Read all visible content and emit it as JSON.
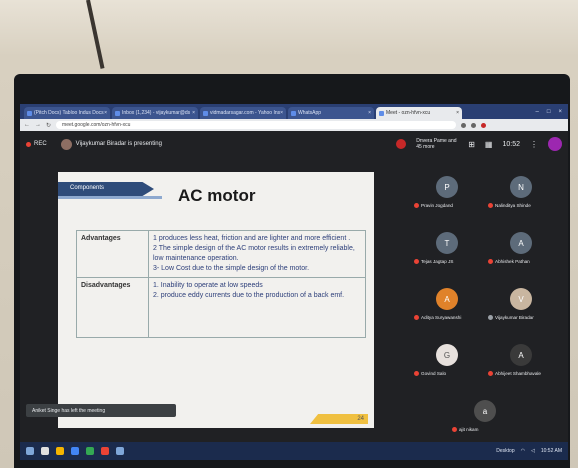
{
  "browser": {
    "tabs": [
      {
        "label": "(Pitch Docs) Tabloo Indus Docs"
      },
      {
        "label": "Inbox (1,234) - vijaykumar@ds"
      },
      {
        "label": "vidmadarsagar.com - Yahoo Ins"
      },
      {
        "label": "WhatsApp"
      },
      {
        "label": "Meet - ozn-hfvn-xcu",
        "active": true
      }
    ],
    "url": "meet.google.com/ozn-hfvn-xcu"
  },
  "meet": {
    "rec_label": "REC",
    "presenting_text": "Vijaykumar Biradar is presenting",
    "participants_label": "Dnvera Pame and 45 more",
    "clock": "10:52",
    "toast": "Aniket Singe has left the meeting",
    "participants": [
      {
        "name": "Pravin Jogdand",
        "initial": "P"
      },
      {
        "name": "Nalinditya Shinde",
        "initial": "N"
      },
      {
        "name": "Tejas Jagtap JS",
        "initial": "T"
      },
      {
        "name": "Abhishek Pathan",
        "initial": "A"
      },
      {
        "name": "Aditya Suryawanshi",
        "initial": "A"
      },
      {
        "name": "Vijaykumar Biradar",
        "initial": "V"
      },
      {
        "name": "Govind Salo",
        "initial": "G"
      },
      {
        "name": "Abhijeet Shambhavale",
        "initial": "A"
      },
      {
        "name": "ajit nikam",
        "initial": "a"
      }
    ]
  },
  "slide": {
    "tag": "Components",
    "title": "AC motor",
    "rows": [
      {
        "head": "Advantages",
        "lines": [
          "1 produces less heat, friction and are lighter and more efficient .",
          "2 The simple design of the AC motor results in extremely reliable, low maintenance operation.",
          "3- Low Cost due to the simple design of the motor."
        ]
      },
      {
        "head": "Disadvantages",
        "lines": [
          "1. Inability to operate at low speeds",
          "2. produce eddy currents due to the production of a back emf."
        ]
      }
    ],
    "page": "24"
  },
  "taskbar": {
    "tray_text": "Desktop",
    "time": "10:52 AM"
  }
}
